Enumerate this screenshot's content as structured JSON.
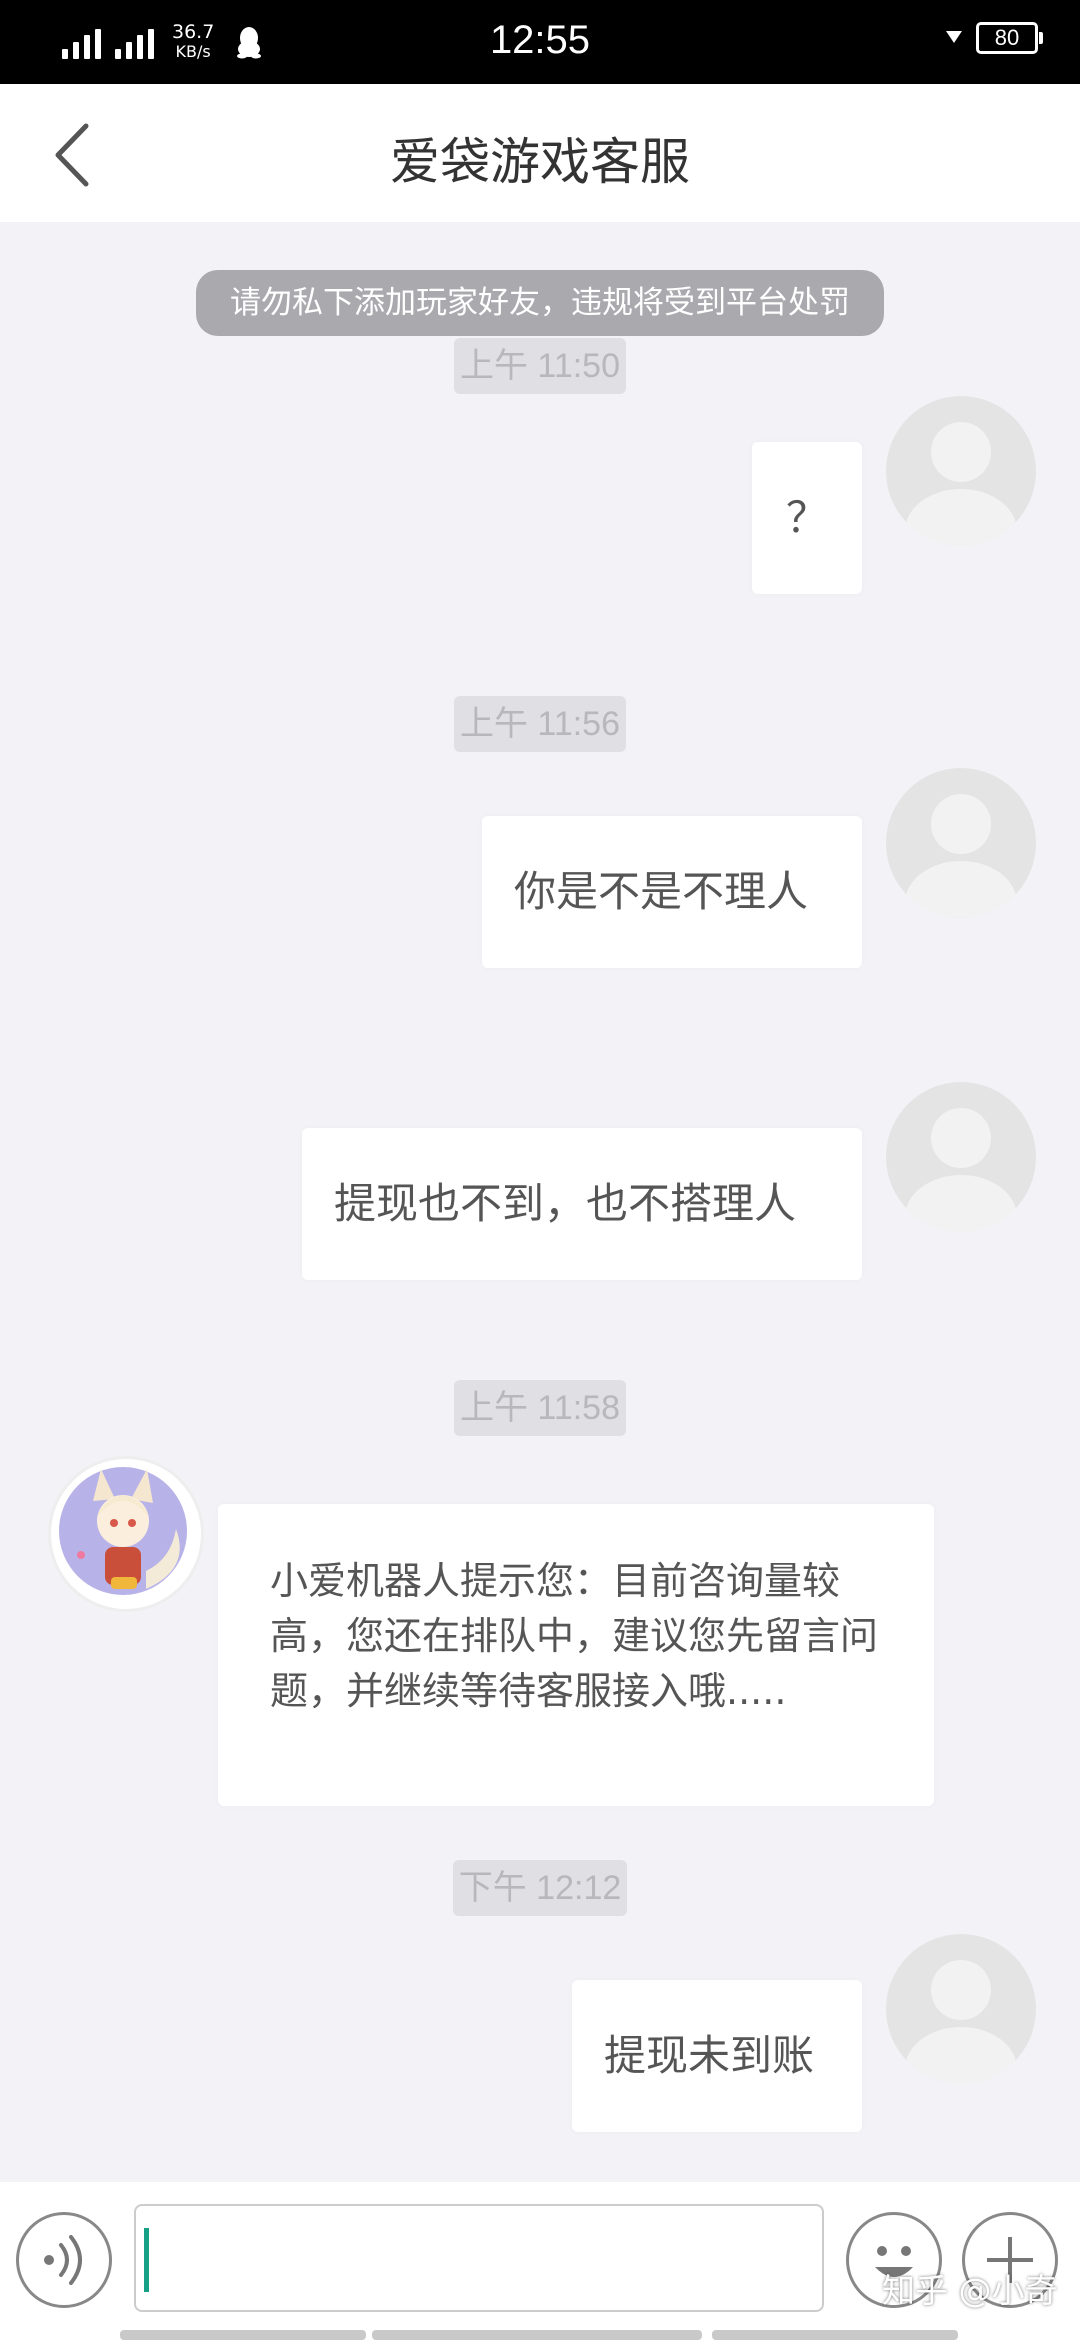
{
  "status_bar": {
    "net_speed_value": "36.7",
    "net_speed_unit": "KB/s",
    "time": "12:55",
    "battery": "80"
  },
  "header": {
    "title": "爱袋游戏客服"
  },
  "notice": "请勿私下添加玩家好友，违规将受到平台处罚",
  "messages": [
    {
      "time": "上午 11:50",
      "text": "？"
    },
    {
      "time": "上午 11:56",
      "text": "你是不是不理人"
    },
    {
      "text": "提现也不到，也不搭理人"
    },
    {
      "time": "上午 11:58",
      "text": "小爱机器人提示您：目前咨询量较高，您还在排队中，建议您先留言问题，并继续等待客服接入哦....."
    },
    {
      "time": "下午 12:12",
      "text": "提现未到账"
    }
  ],
  "input": {
    "value": "",
    "cursor_color": "#16a085"
  },
  "icons": [
    "back-arrow-icon",
    "voice-icon",
    "emoji-icon",
    "plus-icon"
  ],
  "watermark": "知乎 @小奇"
}
